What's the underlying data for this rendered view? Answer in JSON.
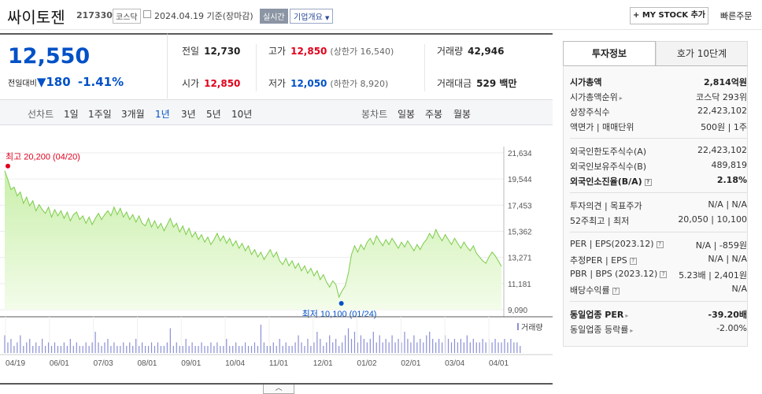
{
  "header": {
    "name": "싸이토젠",
    "code": "217330",
    "market": "코스닥",
    "date": "2024.04.19 기준(장마감)",
    "realtime": "실시간",
    "company_info": "기업개요",
    "mystock": "+ MY STOCK 추가",
    "quick_order": "빠른주문"
  },
  "price": {
    "current": "12,550",
    "change_label": "전일대비",
    "change_value": "180",
    "change_pct": "-1.41%"
  },
  "stats": {
    "prev_label": "전일",
    "prev_value": "12,730",
    "high_label": "고가",
    "high_value": "12,850",
    "high_sub": "(상한가 16,540)",
    "volume_label": "거래량",
    "volume_value": "42,946",
    "open_label": "시가",
    "open_value": "12,850",
    "low_label": "저가",
    "low_value": "12,050",
    "low_sub": "(하한가 8,920)",
    "amount_label": "거래대금",
    "amount_value": "529 백만"
  },
  "tabs": {
    "line_label": "선차트",
    "line_periods": [
      "1일",
      "1주일",
      "3개월",
      "1년",
      "3년",
      "5년",
      "10년"
    ],
    "active_period": "1년",
    "candle_label": "봉차트",
    "candle_periods": [
      "일봉",
      "주봉",
      "월봉"
    ]
  },
  "chart_data": {
    "type": "area",
    "y_ticks": [
      "21,634",
      "19,544",
      "17,453",
      "15,362",
      "13,271",
      "11,181",
      "9,090"
    ],
    "ylim": [
      9090,
      21634
    ],
    "x_ticks": [
      "04/19",
      "06/01",
      "07/03",
      "08/01",
      "09/01",
      "10/04",
      "11/01",
      "12/01",
      "01/02",
      "02/01",
      "03/04",
      "04/01"
    ],
    "high_annotation": "최고 20,200 (04/20)",
    "low_annotation": "최저 10,100 (01/24)",
    "volume_label": "거래량",
    "values": [
      20200,
      19500,
      18700,
      18900,
      18200,
      18500,
      17600,
      18100,
      17400,
      17800,
      17000,
      17500,
      17100,
      16800,
      17300,
      16500,
      17100,
      16600,
      17000,
      16400,
      16900,
      16200,
      16700,
      16900,
      16300,
      16600,
      16000,
      16500,
      15900,
      16400,
      16800,
      16300,
      16700,
      17000,
      16600,
      17300,
      16700,
      17200,
      16500,
      16900,
      16300,
      16700,
      16100,
      16600,
      16000,
      15800,
      16400,
      15700,
      16200,
      15600,
      16000,
      15400,
      15900,
      16400,
      15700,
      16000,
      15300,
      15800,
      15100,
      15600,
      14900,
      15300,
      14700,
      15100,
      14500,
      14900,
      14300,
      14700,
      15200,
      14600,
      15000,
      14400,
      14800,
      14200,
      14600,
      14000,
      14400,
      13800,
      14200,
      13500,
      13900,
      13300,
      13700,
      13100,
      13500,
      13900,
      13300,
      13700,
      13000,
      12700,
      13200,
      12600,
      13000,
      12400,
      12800,
      12200,
      12600,
      12000,
      12400,
      11800,
      12200,
      11500,
      11900,
      11300,
      10900,
      11400,
      11100,
      10100,
      10600,
      11000,
      12000,
      13500,
      14200,
      13700,
      14300,
      13900,
      14500,
      14800,
      14300,
      15000,
      14600,
      14200,
      14700,
      14300,
      14800,
      14400,
      14000,
      14500,
      14100,
      14600,
      14200,
      13800,
      14300,
      13900,
      14400,
      14700,
      15200,
      14800,
      15500,
      15000,
      14600,
      15100,
      14700,
      14300,
      14800,
      14400,
      14000,
      14500,
      14100,
      13800,
      14200,
      13600,
      13300,
      13000,
      12800,
      13300,
      13700,
      13400,
      13000,
      12550
    ],
    "volume": [
      5,
      3,
      4,
      2,
      3,
      5,
      2,
      3,
      4,
      2,
      3,
      2,
      4,
      2,
      3,
      2,
      3,
      2,
      2,
      3,
      2,
      4,
      2,
      3,
      2,
      2,
      3,
      2,
      3,
      6,
      3,
      2,
      3,
      4,
      2,
      3,
      2,
      2,
      3,
      2,
      3,
      2,
      4,
      2,
      3,
      2,
      2,
      3,
      2,
      3,
      2,
      2,
      3,
      7,
      2,
      3,
      2,
      2,
      4,
      2,
      3,
      2,
      2,
      3,
      2,
      2,
      3,
      2,
      3,
      2,
      2,
      4,
      2,
      2,
      3,
      2,
      2,
      3,
      2,
      2,
      3,
      2,
      8,
      3,
      2,
      2,
      3,
      2,
      4,
      2,
      3,
      2,
      2,
      3,
      5,
      3,
      2,
      4,
      2,
      3,
      6,
      4,
      2,
      3,
      5,
      3,
      4,
      2,
      3,
      5,
      7,
      4,
      6,
      3,
      5,
      4,
      3,
      4,
      6,
      3,
      5,
      3,
      4,
      3,
      5,
      3,
      4,
      3,
      6,
      4,
      3,
      5,
      3,
      4,
      3,
      5,
      6,
      4,
      3,
      4,
      3,
      5,
      4,
      3,
      4,
      3,
      4,
      3,
      5,
      3,
      4,
      3,
      3,
      4,
      3,
      4,
      3,
      4,
      3,
      3,
      4,
      3,
      4,
      3,
      3,
      2
    ]
  },
  "sidebar": {
    "tab_invest": "투자정보",
    "tab_hoga": "호가 10단계",
    "market_cap_label": "시가총액",
    "market_cap_value": "2,814억원",
    "market_cap_rank_label": "시가총액순위",
    "market_cap_rank_value": "코스닥 293위",
    "shares_label": "상장주식수",
    "shares_value": "22,423,102",
    "par_label": "액면가 | 매매단위",
    "par_value": "500원 | 1주",
    "foreign_limit_label": "외국인한도주식수(A)",
    "foreign_limit_value": "22,423,102",
    "foreign_hold_label": "외국인보유주식수(B)",
    "foreign_hold_value": "489,819",
    "foreign_ratio_label": "외국인소진율(B/A)",
    "foreign_ratio_value": "2.18%",
    "opinion_label": "투자의견 | 목표주가",
    "opinion_value": "N/A | N/A",
    "week52_label": "52주최고 | 최저",
    "week52_value": "20,050 | 10,100",
    "per_label": "PER | EPS(2023.12)",
    "per_value": "N/A | -859원",
    "est_per_label": "추정PER | EPS",
    "est_per_value": "N/A | N/A",
    "pbr_label": "PBR | BPS (2023.12)",
    "pbr_value": "5.23배 | 2,401원",
    "div_label": "배당수익률",
    "div_value": "N/A",
    "sector_per_label": "동일업종 PER",
    "sector_per_value": "-39.20배",
    "sector_rate_label": "동일업종 등락률",
    "sector_rate_value": "-2.00%"
  }
}
